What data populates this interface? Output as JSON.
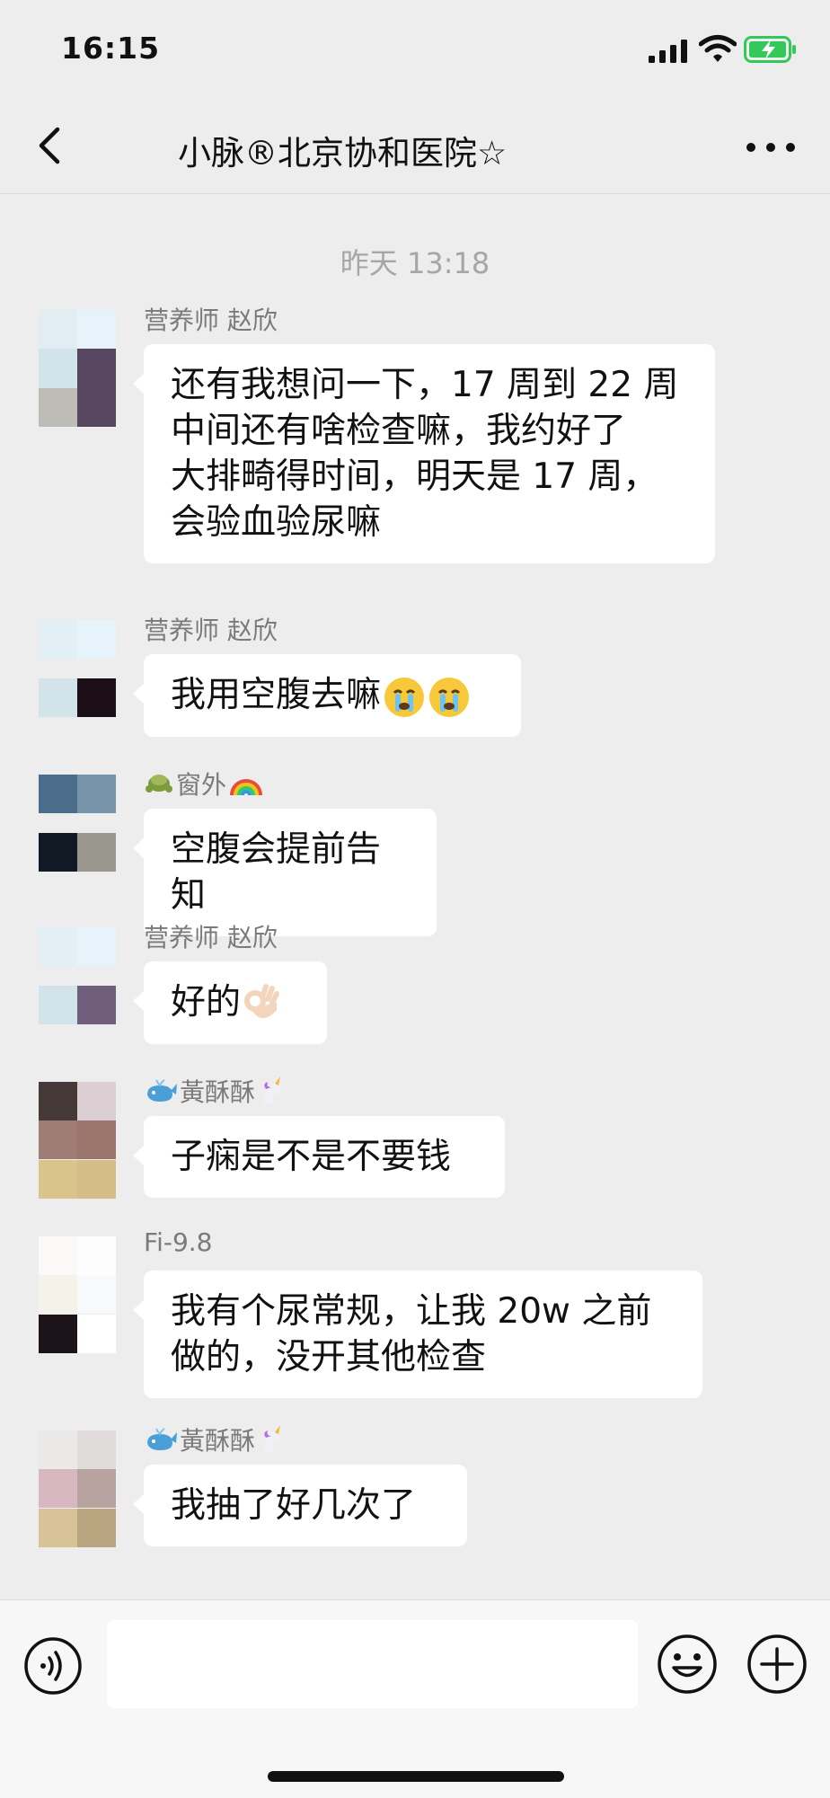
{
  "status_bar": {
    "time": "16:15",
    "icons": [
      "signal-icon",
      "wifi-icon",
      "battery-charging-icon"
    ]
  },
  "nav": {
    "title": "小脉®北京协和医院☆",
    "back_icon": "chevron-left-icon",
    "more_icon": "more-dots-icon"
  },
  "chat": {
    "timestamp": "昨天 13:18",
    "messages": [
      {
        "sender": "营养师  赵欣",
        "lines": [
          "还有我想问一下，17 周到 22 周",
          "中间还有啥检查嘛，我约好了",
          "大排畸得时间，明天是 17 周，",
          "会验血验尿嘛"
        ]
      },
      {
        "sender": "营养师  赵欣",
        "text": "我用空腹去嘛",
        "emoji": "crying-face-emoji"
      },
      {
        "sender": "窗外",
        "sender_emoji": [
          "turtle-emoji",
          "rainbow-emoji"
        ],
        "text": "空腹会提前告知"
      },
      {
        "sender": "营养师  赵欣",
        "text": "好的",
        "emoji": "ok-hand-emoji"
      },
      {
        "sender": "黃酥酥",
        "sender_emoji": [
          "whale-emoji",
          "unicorn-emoji"
        ],
        "text": "子痫是不是不要钱"
      },
      {
        "sender": "Fi-9.8",
        "lines": [
          "我有个尿常规，让我 20w 之前",
          "做的，没开其他检查"
        ]
      },
      {
        "sender": "黃酥酥",
        "sender_emoji": [
          "whale-emoji",
          "unicorn-emoji"
        ],
        "text": "我抽了好几次了"
      }
    ]
  },
  "input_bar": {
    "icons": [
      "voice-icon",
      "emoji-icon",
      "plus-icon"
    ],
    "value": ""
  },
  "colors": {
    "background": "#ededed",
    "bubble": "#ffffff",
    "accent_battery": "#34c759"
  }
}
